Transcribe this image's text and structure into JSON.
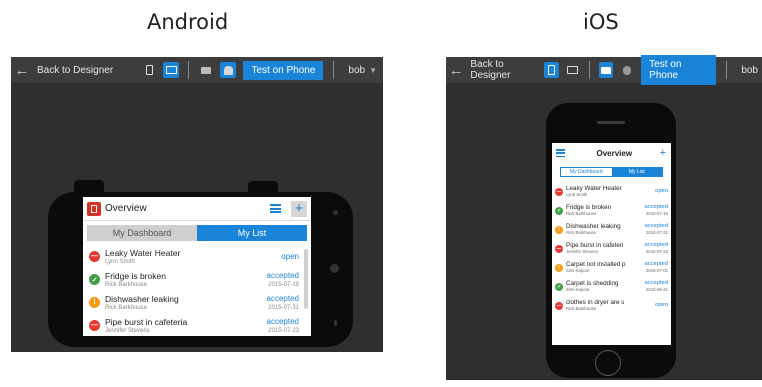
{
  "headings": {
    "android": "Android",
    "ios": "iOS"
  },
  "toolbar": {
    "back_label": "Back to Designer",
    "test_label": "Test on Phone",
    "user": "bob"
  },
  "android_app": {
    "title": "Overview",
    "tabs": [
      "My Dashboard",
      "My List"
    ],
    "items": [
      {
        "title": "Leaky Water Heater",
        "person": "Lynn Smith",
        "status": "open",
        "date": "",
        "color": "red"
      },
      {
        "title": "Fridge is broken",
        "person": "Rick Barkhouse",
        "status": "accepted",
        "date": "2015-07-19",
        "color": "green"
      },
      {
        "title": "Dishwasher leaking",
        "person": "Rick Barkhouse",
        "status": "accepted",
        "date": "2015-07-31",
        "color": "orange"
      },
      {
        "title": "Pipe burst in cafeteria",
        "person": "Jennifer Stevens",
        "status": "accepted",
        "date": "2015-07-23",
        "color": "red"
      }
    ]
  },
  "ios_app": {
    "title": "Overview",
    "tabs": [
      "My Dashboard",
      "My List"
    ],
    "items": [
      {
        "title": "Leaky Water Heater",
        "person": "Lynn Smith",
        "status": "open",
        "date": "",
        "color": "red"
      },
      {
        "title": "Fridge is broken",
        "person": "Rick Barkhouse",
        "status": "accepted",
        "date": "2015-07-19",
        "color": "green"
      },
      {
        "title": "Dishwasher leaking",
        "person": "Rick Barkhouse",
        "status": "accepted",
        "date": "2015-07-31",
        "color": "orange"
      },
      {
        "title": "Pipe burst in cafeteri",
        "person": "Jennifer Stevens",
        "status": "accepted",
        "date": "2015-07-23",
        "color": "red"
      },
      {
        "title": "Carpet not installed p",
        "person": "Simi Kapoor",
        "status": "accepted",
        "date": "2015-07-01",
        "color": "orange"
      },
      {
        "title": "Carpet is shedding",
        "person": "Simi Kapoor",
        "status": "accepted",
        "date": "2015-06-21",
        "color": "green"
      },
      {
        "title": "clothes in dryer are s",
        "person": "Rick Barkhouse",
        "status": "open",
        "date": "",
        "color": "red"
      }
    ]
  },
  "colors": {
    "accent": "#1a84d8",
    "panel_bg": "#2f2f2f",
    "toolbar_bg": "#3d3d3d"
  },
  "icons": [
    "back-arrow-icon",
    "phone-icon",
    "tablet-icon",
    "keyboard-icon",
    "android-icon",
    "apple-icon",
    "menu-icon",
    "plus-icon"
  ]
}
